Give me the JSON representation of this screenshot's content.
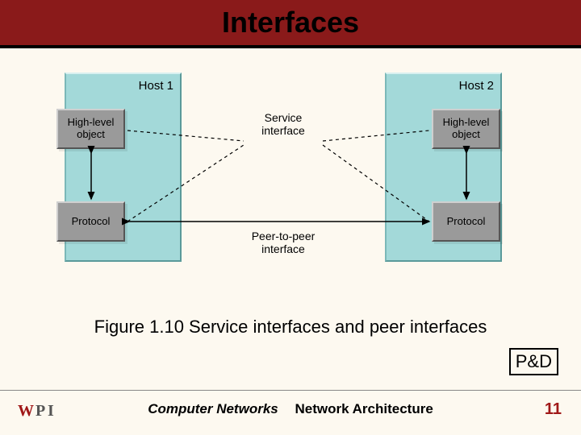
{
  "title": "Interfaces",
  "diagram": {
    "host1_label": "Host 1",
    "host2_label": "Host 2",
    "highlevel_label": "High-level\nobject",
    "protocol_label": "Protocol",
    "service_interface_label": "Service\ninterface",
    "peer_interface_label": "Peer-to-peer\ninterface"
  },
  "caption": "Figure 1.10 Service interfaces and peer interfaces",
  "source_box": "P&D",
  "footer": {
    "left": "Computer Networks",
    "right": "Network Architecture"
  },
  "page_number": "11",
  "logo_text": "WPI"
}
